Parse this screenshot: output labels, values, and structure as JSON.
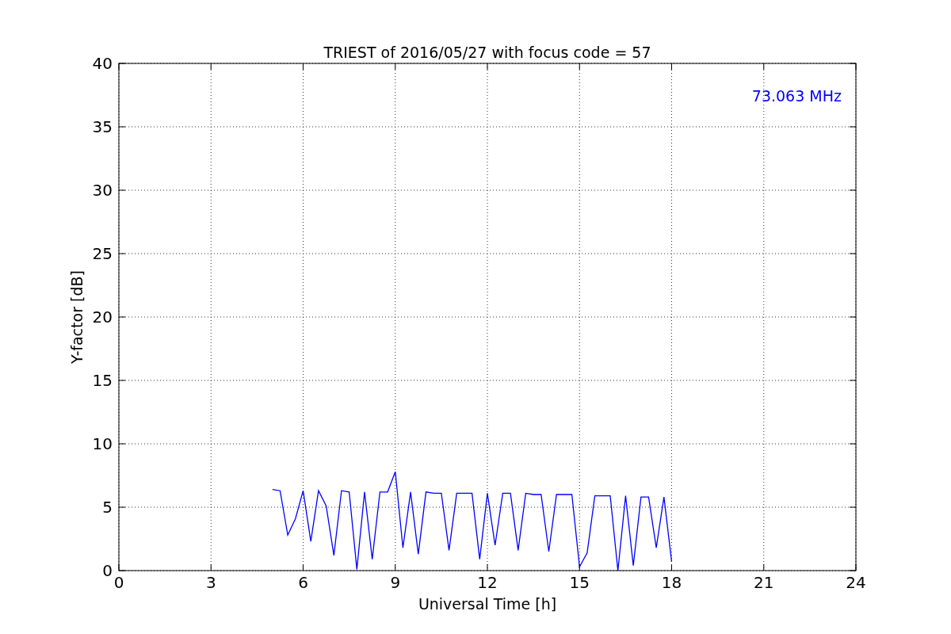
{
  "chart_data": {
    "type": "line",
    "title": "TRIEST of 2016/05/27 with focus code = 57",
    "xlabel": "Universal Time [h]",
    "ylabel": "Y-factor [dB]",
    "xlim": [
      0,
      24
    ],
    "ylim": [
      0,
      40
    ],
    "xticks": [
      0,
      3,
      6,
      9,
      12,
      15,
      18,
      21,
      24
    ],
    "yticks": [
      0,
      5,
      10,
      15,
      20,
      25,
      30,
      35,
      40
    ],
    "x": [
      5,
      5.25,
      5.5,
      5.75,
      6,
      6.25,
      6.5,
      6.75,
      7,
      7.25,
      7.5,
      7.75,
      8,
      8.25,
      8.5,
      8.75,
      9,
      9.25,
      9.5,
      9.75,
      10,
      10.25,
      10.5,
      10.75,
      11,
      11.25,
      11.5,
      11.75,
      12,
      12.25,
      12.5,
      12.75,
      13,
      13.25,
      13.5,
      13.75,
      14,
      14.25,
      14.5,
      14.75,
      15,
      15.25,
      15.5,
      15.75,
      16,
      16.25,
      16.5,
      16.75,
      17,
      17.25,
      17.5,
      17.75,
      18
    ],
    "series": [
      {
        "name": "73.063 MHz",
        "color": "#0000ff",
        "values": [
          6.4,
          6.3,
          2.8,
          4.1,
          6.3,
          2.3,
          6.3,
          5.1,
          1.2,
          6.3,
          6.2,
          0.1,
          6.2,
          0.9,
          6.2,
          6.2,
          7.8,
          1.8,
          6.2,
          1.3,
          6.2,
          6.1,
          6.1,
          1.6,
          6.1,
          6.1,
          6.1,
          0.9,
          6.1,
          2.0,
          6.1,
          6.1,
          1.6,
          6.1,
          6.0,
          6.0,
          1.5,
          6.0,
          6.0,
          6.0,
          0.3,
          1.4,
          5.9,
          5.9,
          5.9,
          0.0,
          5.9,
          0.4,
          5.8,
          5.8,
          1.8,
          5.8,
          0.7
        ]
      }
    ],
    "grid": true
  }
}
